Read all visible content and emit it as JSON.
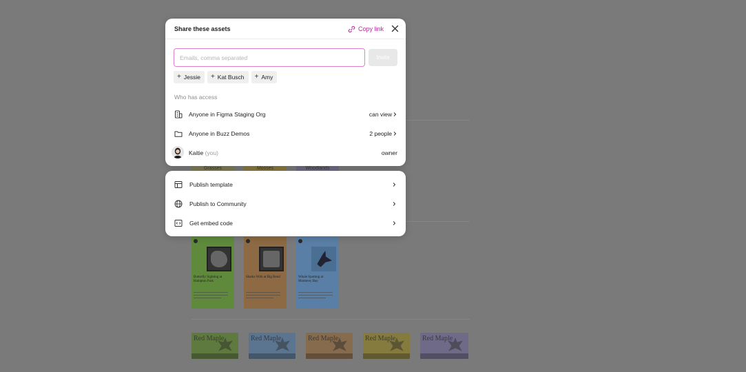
{
  "share": {
    "title": "Share these assets",
    "copy_link": "Copy link",
    "email_placeholder": "Emails, comma separated",
    "invite_label": "Invite",
    "suggestions": [
      "Jessie",
      "Kat Busch",
      "Amy"
    ],
    "access_label": "Who has access",
    "access": [
      {
        "name": "Anyone in Figma Staging Org",
        "permission": "can view",
        "icon": "org-icon"
      },
      {
        "name": "Anyone in Buzz Demos",
        "permission": "2 people",
        "icon": "folder-icon"
      },
      {
        "name": "Kaitie",
        "suffix": "(you)",
        "permission": "owner",
        "icon": "avatar"
      }
    ],
    "accent_color": "#b3329b"
  },
  "actions": [
    {
      "label": "Publish template",
      "icon": "template-icon"
    },
    {
      "label": "Publish to Community",
      "icon": "globe-icon"
    },
    {
      "label": "Get embed code",
      "icon": "embed-icon"
    }
  ],
  "background": {
    "label_fragments": [
      "Grasses",
      "Mosses",
      "Woodlands"
    ],
    "posters": [
      {
        "title": "Butterfly Sighting at Hampton Park",
        "color": "#5f8a3c"
      },
      {
        "title": "Sharks With at Big Bend",
        "color": "#8d6a43"
      },
      {
        "title": "Whale Spotting at Monterey Bay",
        "color": "#5a7fa6"
      }
    ],
    "strips": [
      {
        "text": "Red Maple",
        "color": "#5f7a3f"
      },
      {
        "text": "Red Maple",
        "color": "#5b7591"
      },
      {
        "text": "Red Maple",
        "color": "#866b4d"
      },
      {
        "text": "Red Maple",
        "color": "#857b3e"
      },
      {
        "text": "Red Maple",
        "color": "#6f6a88"
      }
    ]
  }
}
